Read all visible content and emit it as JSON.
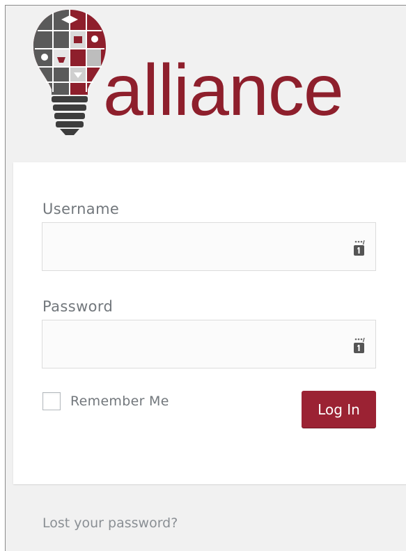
{
  "logo": {
    "wordmark": "alliance",
    "colors": {
      "maroon": "#8e1f2c",
      "dark_gray": "#3d3d3d"
    }
  },
  "form": {
    "username_label": "Username",
    "username_value": "",
    "password_label": "Password",
    "password_value": "",
    "field_icon": "password-manager-key-icon",
    "remember_label": "Remember Me",
    "remember_checked": false,
    "login_button": "Log In",
    "accent_color": "#9b2233"
  },
  "links": {
    "lost_password": "Lost your password?"
  }
}
